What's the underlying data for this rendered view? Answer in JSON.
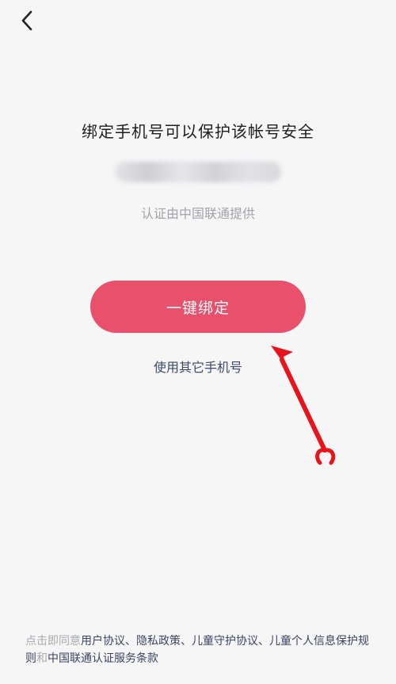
{
  "header": {
    "back_icon": "chevron-left-icon"
  },
  "main": {
    "title": "绑定手机号可以保护该帐号安全",
    "provider_text": "认证由中国联通提供",
    "bind_button_label": "一键绑定",
    "other_phone_label": "使用其它手机号"
  },
  "annotation": {
    "arrow_color": "#e8141b"
  },
  "terms": {
    "prefix": "点击即同意",
    "user_agreement": "用户协议",
    "sep1": "、",
    "privacy_policy": "隐私政策",
    "sep2": "、",
    "child_protection": "儿童守护协议",
    "sep3": "、",
    "child_info_rules": "儿童个人信息保护规则",
    "and": "和",
    "unicom_terms": "中国联通认证服务条款"
  },
  "colors": {
    "accent": "#e9506c",
    "link": "#3b4a6b",
    "muted": "#a3a3a8"
  }
}
